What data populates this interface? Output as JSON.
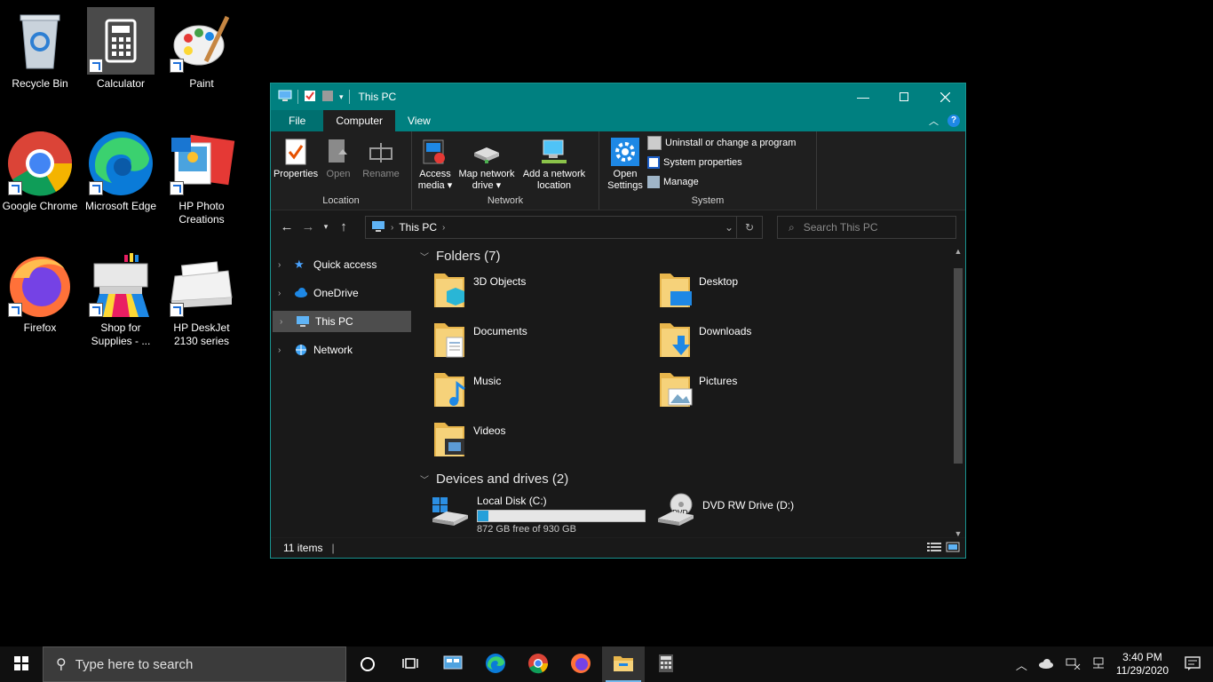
{
  "desktop": {
    "icons": [
      {
        "label": "Recycle Bin"
      },
      {
        "label": "Calculator"
      },
      {
        "label": "Paint"
      },
      {
        "label": "Google Chrome"
      },
      {
        "label": "Microsoft Edge"
      },
      {
        "label": "HP Photo Creations"
      },
      {
        "label": "Firefox"
      },
      {
        "label": "Shop for Supplies - ..."
      },
      {
        "label": "HP DeskJet 2130 series"
      }
    ]
  },
  "window": {
    "title": "This PC",
    "accent_color": "#008080",
    "tabs": {
      "file": "File",
      "computer": "Computer",
      "view": "View"
    },
    "ribbon": {
      "location_group": "Location",
      "properties": "Properties",
      "open": "Open",
      "rename": "Rename",
      "network_group": "Network",
      "access_media_1": "Access",
      "access_media_2": "media",
      "map_drive_1": "Map network",
      "map_drive_2": "drive",
      "add_location_1": "Add a network",
      "add_location_2": "location",
      "system_group": "System",
      "open_settings_1": "Open",
      "open_settings_2": "Settings",
      "uninstall": "Uninstall or change a program",
      "system_properties": "System properties",
      "manage": "Manage"
    },
    "address": {
      "path": "This PC",
      "search_placeholder": "Search This PC"
    },
    "nav": {
      "quick_access": "Quick access",
      "onedrive": "OneDrive",
      "this_pc": "This PC",
      "network": "Network"
    },
    "folders_header": "Folders (7)",
    "folders": [
      {
        "label": "3D Objects"
      },
      {
        "label": "Desktop"
      },
      {
        "label": "Documents"
      },
      {
        "label": "Downloads"
      },
      {
        "label": "Music"
      },
      {
        "label": "Pictures"
      },
      {
        "label": "Videos"
      }
    ],
    "drives_header": "Devices and drives (2)",
    "drives": {
      "c_label": "Local Disk (C:)",
      "c_free": "872 GB free of 930 GB",
      "c_used_fraction": 0.0624,
      "d_label": "DVD RW Drive (D:)",
      "d_badge": "DVD"
    },
    "status": {
      "count": "11 items"
    }
  },
  "taskbar": {
    "search_placeholder": "Type here to search",
    "time": "3:40 PM",
    "date": "11/29/2020"
  }
}
